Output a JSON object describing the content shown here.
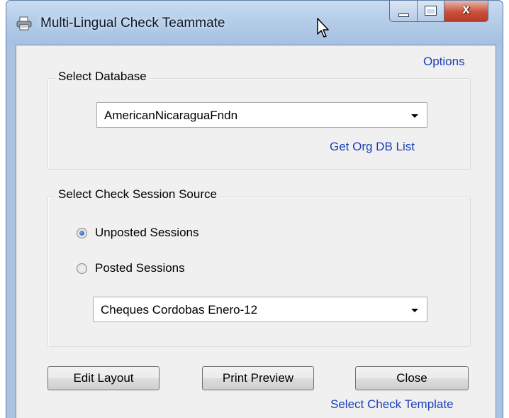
{
  "window": {
    "title": "Multi-Lingual Check Teammate",
    "icon": "printer-icon",
    "controls": {
      "minimize": "minimize-icon",
      "maximize": "maximize-icon",
      "close_glyph": "x"
    }
  },
  "options_link": "Options",
  "database_group": {
    "legend": "Select Database",
    "selected": "AmericanNicaraguaFndn",
    "link": "Get Org DB List"
  },
  "session_group": {
    "legend": "Select Check Session Source",
    "radios": [
      {
        "label": "Unposted Sessions",
        "checked": true
      },
      {
        "label": "Posted Sessions",
        "checked": false
      }
    ],
    "selected": "Cheques Cordobas Enero-12"
  },
  "buttons": {
    "edit_layout": "Edit Layout",
    "print_preview": "Print Preview",
    "close": "Close"
  },
  "template_link": "Select Check Template"
}
